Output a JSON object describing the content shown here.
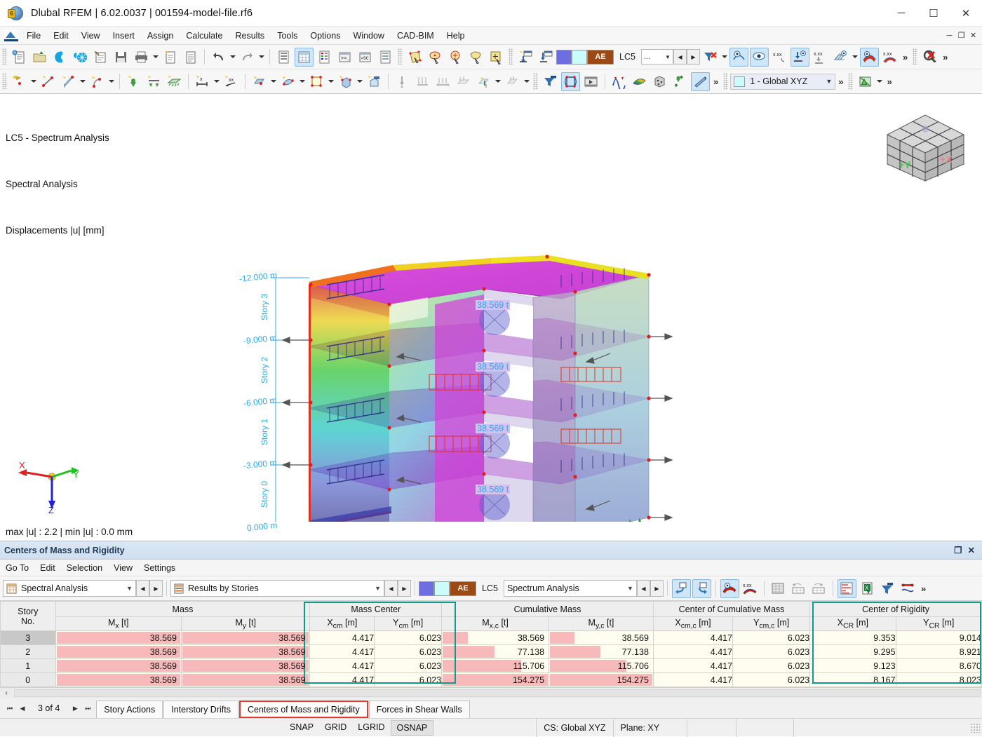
{
  "window": {
    "title": "Dlubal RFEM | 6.02.0037 | 001594-model-file.rf6",
    "minimize": "─",
    "maximize": "☐",
    "close": "✕"
  },
  "menubar": {
    "items": [
      "File",
      "Edit",
      "View",
      "Insert",
      "Assign",
      "Calculate",
      "Results",
      "Tools",
      "Options",
      "Window",
      "CAD-BIM",
      "Help"
    ],
    "mdi": [
      "─",
      "❐",
      "✕"
    ]
  },
  "toolbar_top": {
    "load_case_label": "LC5",
    "load_case_combo": "...",
    "ae_label": "AE",
    "swatch_blue": "#6e6ee0",
    "swatch_cyan": "#ccfbfb",
    "swatch_ae": "#9c4a15",
    "overflow": "»"
  },
  "toolbar_second": {
    "cs_combo": "1 - Global XYZ",
    "overflow": "»"
  },
  "viewport": {
    "legend_line1": "LC5 - Spectrum Analysis",
    "legend_line2": "Spectral Analysis",
    "legend_line3": "Displacements |u| [mm]",
    "minmax": "max |u| : 2.2 | min |u| : 0.0 mm",
    "elevations": [
      "-12.000 m",
      "-9.000 m",
      "-6.000 m",
      "-3.000 m",
      "0.000 m"
    ],
    "stories": [
      "Story 3",
      "Story 2",
      "Story 1",
      "Story 0"
    ],
    "mass_labels": [
      "38.569 t",
      "38.569 t",
      "38.569 t",
      "38.569 t"
    ],
    "viewcube": {
      "face_y": "+Y",
      "face_x": "+X"
    },
    "tripod": {
      "x": "X",
      "y": "Y",
      "z": "Z"
    },
    "origin_axes": {
      "x": "X",
      "y": "Y",
      "z": "Z"
    }
  },
  "panel": {
    "title": "Centers of Mass and Rigidity",
    "restore_icon": "❐",
    "close_icon": "✕",
    "menu": [
      "Go To",
      "Edit",
      "Selection",
      "View",
      "Settings"
    ],
    "combo_analysis": "Spectral Analysis",
    "combo_results": "Results by Stories",
    "lc_code": "LC5",
    "combo_loadcase": "Spectrum Analysis",
    "ae_label": "AE",
    "overflow": "»"
  },
  "table": {
    "group_headers": [
      {
        "label": "",
        "span": 1
      },
      {
        "label": "Mass",
        "span": 2
      },
      {
        "label": "Mass Center",
        "span": 2,
        "highlight": true
      },
      {
        "label": "Cumulative Mass",
        "span": 2
      },
      {
        "label": "Center of Cumulative Mass",
        "span": 2
      },
      {
        "label": "Center of Rigidity",
        "span": 2,
        "highlight": true
      }
    ],
    "column_headers": [
      "Story\nNo.",
      "Mx [t]",
      "My [t]",
      "Xcm [m]",
      "Ycm [m]",
      "Mx,c [t]",
      "My,c [t]",
      "Xcm,c [m]",
      "Ycm,c [m]",
      "XCR [m]",
      "YCR [m]"
    ],
    "column_headers_rich": [
      {
        "base": "Story",
        "base2": "No."
      },
      {
        "base": "M",
        "sub": "x",
        "unit": " [t]"
      },
      {
        "base": "M",
        "sub": "y",
        "unit": " [t]"
      },
      {
        "base": "X",
        "sub": "cm",
        "unit": " [m]"
      },
      {
        "base": "Y",
        "sub": "cm",
        "unit": " [m]"
      },
      {
        "base": "M",
        "sub": "x,c",
        "unit": " [t]"
      },
      {
        "base": "M",
        "sub": "y,c",
        "unit": " [t]"
      },
      {
        "base": "X",
        "sub": "cm,c",
        "unit": " [m]"
      },
      {
        "base": "Y",
        "sub": "cm,c",
        "unit": " [m]"
      },
      {
        "base": "X",
        "sub": "CR",
        "unit": " [m]"
      },
      {
        "base": "Y",
        "sub": "CR",
        "unit": " [m]"
      }
    ],
    "rows": [
      {
        "story": "3",
        "selected": true,
        "mx": "38.569",
        "my": "38.569",
        "xcm": "4.417",
        "ycm": "6.023",
        "mxc": "38.569",
        "myc": "38.569",
        "xcmc": "4.417",
        "ycmc": "6.023",
        "xcr": "9.353",
        "ycr": "9.014",
        "mx_pct": 100,
        "my_pct": 100,
        "mxc_pct": 25,
        "myc_pct": 25
      },
      {
        "story": "2",
        "selected": false,
        "mx": "38.569",
        "my": "38.569",
        "xcm": "4.417",
        "ycm": "6.023",
        "mxc": "77.138",
        "myc": "77.138",
        "xcmc": "4.417",
        "ycmc": "6.023",
        "xcr": "9.295",
        "ycr": "8.921",
        "mx_pct": 100,
        "my_pct": 100,
        "mxc_pct": 50,
        "myc_pct": 50
      },
      {
        "story": "1",
        "selected": false,
        "mx": "38.569",
        "my": "38.569",
        "xcm": "4.417",
        "ycm": "6.023",
        "mxc": "115.706",
        "myc": "115.706",
        "xcmc": "4.417",
        "ycmc": "6.023",
        "xcr": "9.123",
        "ycr": "8.670",
        "mx_pct": 100,
        "my_pct": 100,
        "mxc_pct": 75,
        "myc_pct": 75
      },
      {
        "story": "0",
        "selected": false,
        "mx": "38.569",
        "my": "38.569",
        "xcm": "4.417",
        "ycm": "6.023",
        "mxc": "154.275",
        "myc": "154.275",
        "xcmc": "4.417",
        "ycmc": "6.023",
        "xcr": "8.167",
        "ycr": "8.023",
        "mx_pct": 100,
        "my_pct": 100,
        "mxc_pct": 100,
        "myc_pct": 100
      }
    ],
    "highlight_color": "#0e9b8a"
  },
  "bottom": {
    "scroll_left": "‹",
    "scroll_right": "›",
    "pager": {
      "first": "⏮",
      "prev": "◀",
      "position": "3 of 4",
      "next": "▶",
      "last": "⏭"
    },
    "tabs": [
      "Story Actions",
      "Interstory Drifts",
      "Centers of Mass and Rigidity",
      "Forces in Shear Walls"
    ],
    "active_tab": "Centers of Mass and Rigidity",
    "active_tab_border": "#e23b2e"
  },
  "statusbar": {
    "snap_buttons": [
      "SNAP",
      "GRID",
      "LGRID",
      "OSNAP"
    ],
    "active_snap": "OSNAP",
    "cs": "CS: Global XYZ",
    "plane": "Plane: XY"
  }
}
